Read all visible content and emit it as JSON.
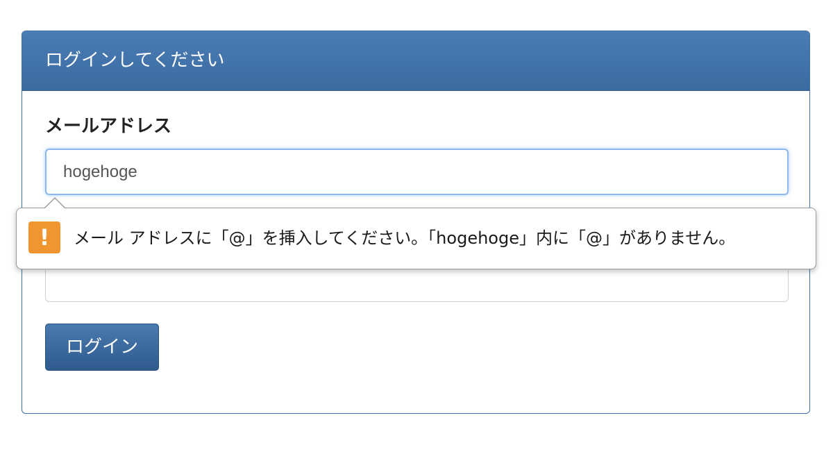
{
  "panel": {
    "title": "ログインしてください"
  },
  "email": {
    "label": "メールアドレス",
    "value": "hogehoge"
  },
  "validation": {
    "icon": "!",
    "message": "メール アドレスに「@」を挿入してください。「hogehoge」内に「@」がありません。"
  },
  "login_button": {
    "label": "ログイン"
  },
  "colors": {
    "header": "#3f6fa8",
    "button": "#3a6699",
    "warning": "#f0952f",
    "focus": "#8db8ec"
  }
}
